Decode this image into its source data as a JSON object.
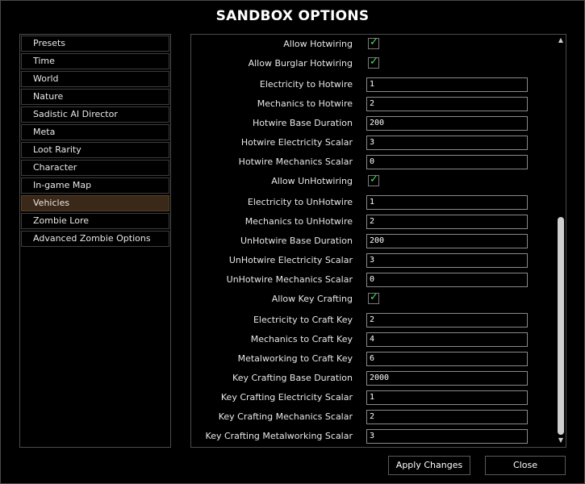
{
  "window": {
    "title": "SANDBOX OPTIONS"
  },
  "categories": [
    {
      "label": "Presets",
      "selected": false
    },
    {
      "label": "Time",
      "selected": false
    },
    {
      "label": "World",
      "selected": false
    },
    {
      "label": "Nature",
      "selected": false
    },
    {
      "label": "Sadistic AI Director",
      "selected": false
    },
    {
      "label": "Meta",
      "selected": false
    },
    {
      "label": "Loot Rarity",
      "selected": false
    },
    {
      "label": "Character",
      "selected": false
    },
    {
      "label": "In-game Map",
      "selected": false
    },
    {
      "label": "Vehicles",
      "selected": true
    },
    {
      "label": "Zombie Lore",
      "selected": false
    },
    {
      "label": "Advanced Zombie Options",
      "selected": false
    }
  ],
  "settings": [
    {
      "label": "Allow Hotwiring",
      "type": "checkbox",
      "checked": true
    },
    {
      "label": "Allow Burglar Hotwiring",
      "type": "checkbox",
      "checked": true
    },
    {
      "label": "Electricity to Hotwire",
      "type": "text",
      "value": "1"
    },
    {
      "label": "Mechanics to Hotwire",
      "type": "text",
      "value": "2"
    },
    {
      "label": "Hotwire Base Duration",
      "type": "text",
      "value": "200"
    },
    {
      "label": "Hotwire Electricity Scalar",
      "type": "text",
      "value": "3"
    },
    {
      "label": "Hotwire Mechanics Scalar",
      "type": "text",
      "value": "0"
    },
    {
      "label": "Allow UnHotwiring",
      "type": "checkbox",
      "checked": true
    },
    {
      "label": "Electricity to UnHotwire",
      "type": "text",
      "value": "1"
    },
    {
      "label": "Mechanics to UnHotwire",
      "type": "text",
      "value": "2"
    },
    {
      "label": "UnHotwire Base Duration",
      "type": "text",
      "value": "200"
    },
    {
      "label": "UnHotwire Electricity Scalar",
      "type": "text",
      "value": "3"
    },
    {
      "label": "UnHotwire Mechanics Scalar",
      "type": "text",
      "value": "0"
    },
    {
      "label": "Allow Key Crafting",
      "type": "checkbox",
      "checked": true
    },
    {
      "label": "Electricity to Craft Key",
      "type": "text",
      "value": "2"
    },
    {
      "label": "Mechanics to Craft Key",
      "type": "text",
      "value": "4"
    },
    {
      "label": "Metalworking to Craft Key",
      "type": "text",
      "value": "6"
    },
    {
      "label": "Key Crafting Base Duration",
      "type": "text",
      "value": "2000"
    },
    {
      "label": "Key Crafting Electricity Scalar",
      "type": "text",
      "value": "1"
    },
    {
      "label": "Key Crafting Mechanics Scalar",
      "type": "text",
      "value": "2"
    },
    {
      "label": "Key Crafting Metalworking Scalar",
      "type": "text",
      "value": "3"
    }
  ],
  "buttons": {
    "apply": "Apply Changes",
    "close": "Close"
  },
  "icons": {
    "check": "✓",
    "scroll_up": "▲",
    "scroll_down": "▼"
  },
  "colors": {
    "accent_check": "#44e060",
    "selected_category_bg": "#3a2818"
  }
}
